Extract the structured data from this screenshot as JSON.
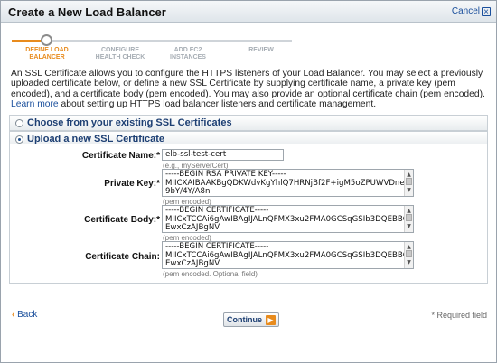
{
  "dialog": {
    "title": "Create a New Load Balancer",
    "cancel_label": "Cancel"
  },
  "wizard": {
    "steps": [
      {
        "line1": "DEFINE LOAD",
        "line2": "BALANCER"
      },
      {
        "line1": "CONFIGURE",
        "line2": "HEALTH CHECK"
      },
      {
        "line1": "ADD EC2",
        "line2": "INSTANCES"
      },
      {
        "line1": "REVIEW",
        "line2": ""
      }
    ],
    "current_step": 1
  },
  "intro": {
    "text": "An SSL Certificate allows you to configure the HTTPS listeners of your Load Balancer. You may select a previously uploaded certificate below, or define a new SSL Certificate by supplying certificate name, a private key (pem encoded), and a certificate body (pem encoded). You may also provide an optional certificate chain (pem encoded).",
    "link": "Learn more",
    "text_after": "about setting up HTTPS load balancer listeners and certificate management."
  },
  "options": {
    "choose_existing_label": "Choose from your existing SSL Certificates",
    "upload_new_label": "Upload a new SSL Certificate",
    "selected": "upload_new"
  },
  "form": {
    "cert_name_label": "Certificate Name:*",
    "cert_name_value": "elb-ssl-test-cert",
    "cert_name_hint": "(e.g., myServerCert)",
    "private_key_label": "Private Key:*",
    "private_key_lines": [
      "-----BEGIN RSA PRIVATE KEY-----",
      "MIICXAIBAAKBgQDKWdvKgYhlQ7HRNjBf2F+igM5oZPUWVDne/0ZQ7o",
      "9bY/4Y/A8n"
    ],
    "private_key_hint": "(pem encoded)",
    "cert_body_label": "Certificate Body:*",
    "cert_body_lines": [
      "-----BEGIN CERTIFICATE-----",
      "MIICxTCCAi6gAwIBAgIJALnQFMX3xu2FMA0GCSqGSIb3DQEBBQUAM",
      "EwxCzAJBgNV"
    ],
    "cert_body_hint": "(pem encoded)",
    "cert_chain_label": "Certificate Chain:",
    "cert_chain_lines": [
      "-----BEGIN CERTIFICATE-----",
      "MIICxTCCAi6gAwIBAgIJALnQFMX3xu2FMA0GCSqGSIb3DQEBBQUAM",
      "EwxCzAJBgNV"
    ],
    "cert_chain_hint": "(pem encoded. Optional field)"
  },
  "footer": {
    "back_arrow": "‹",
    "back_label": "Back",
    "continue_label": "Continue",
    "required_note": "* Required field"
  },
  "colors": {
    "accent": "#e88b1d",
    "link": "#1a4f9c",
    "heading": "#1d3f73"
  },
  "icons": {
    "close": "close-icon",
    "continue_arrow": "arrow-right-icon",
    "back_arrow": "chevron-left-icon"
  }
}
